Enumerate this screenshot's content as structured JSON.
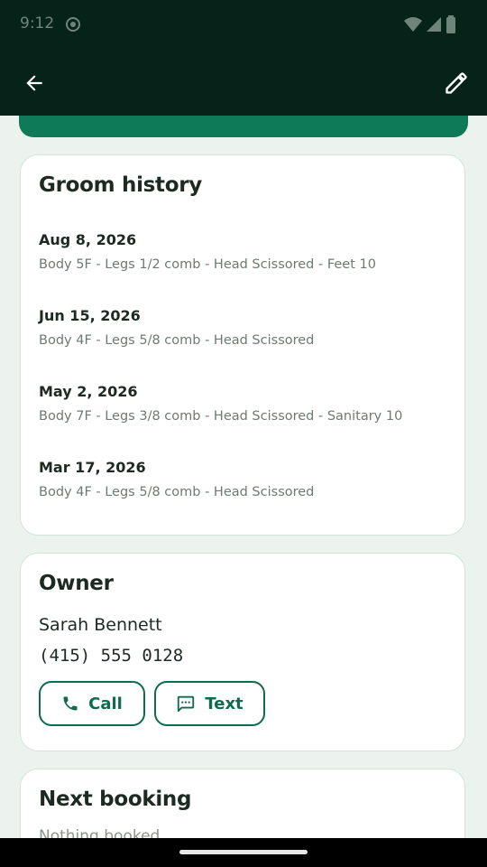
{
  "status_bar": {
    "time": "9:12"
  },
  "colors": {
    "app_bar": "#06231A",
    "accent": "#0F6B4E",
    "background": "#ECF3EE"
  },
  "icons": [
    "back-arrow-icon",
    "pencil-edit-icon",
    "phone-icon",
    "message-icon"
  ],
  "history": {
    "title": "Groom history",
    "entries": [
      {
        "date": "Aug 8, 2026",
        "details": "Body 5F  -  Legs 1/2 comb  -  Head Scissored  -  Feet 10"
      },
      {
        "date": "Jun 15, 2026",
        "details": "Body 4F  -  Legs 5/8 comb  -  Head Scissored"
      },
      {
        "date": "May 2, 2026",
        "details": "Body 7F  -  Legs 3/8 comb  -  Head Scissored  -  Sanitary 10"
      },
      {
        "date": "Mar 17, 2026",
        "details": "Body 4F  -  Legs 5/8 comb  -  Head Scissored"
      }
    ]
  },
  "owner": {
    "title": "Owner",
    "name": "Sarah Bennett",
    "phone": "(415) 555 0128",
    "call_label": "Call",
    "text_label": "Text"
  },
  "next_booking": {
    "title": "Next booking",
    "empty_text": "Nothing booked"
  }
}
